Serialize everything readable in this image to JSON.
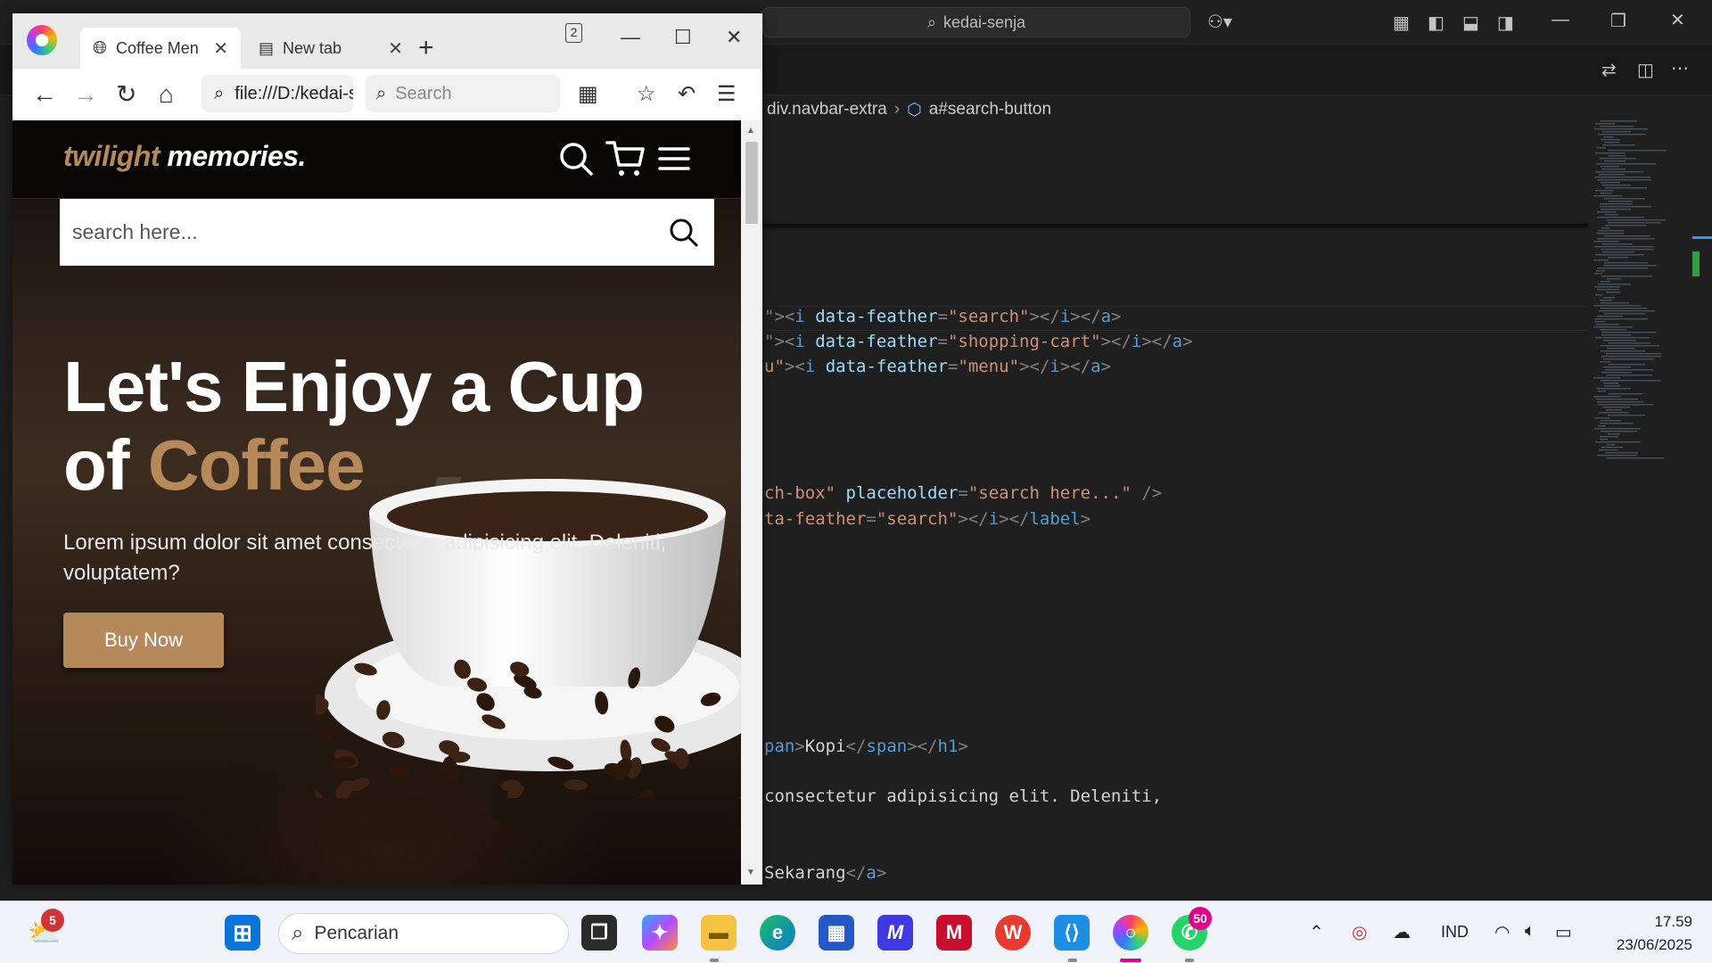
{
  "vscode": {
    "command_center": "kedai-senja",
    "breadcrumb": [
      "div.navbar-extra",
      "a#search-button"
    ],
    "code_lines": [
      {
        "parts": [
          [
            "punc",
            "\">"
          ],
          [
            "punc",
            "<"
          ],
          [
            "tag",
            "i"
          ],
          [
            "attr",
            " data-feather"
          ],
          [
            "punc",
            "="
          ],
          [
            "str",
            "\"search\""
          ],
          [
            "punc",
            "></"
          ],
          [
            "tag",
            "i"
          ],
          [
            "punc",
            "></"
          ],
          [
            "tag",
            "a"
          ],
          [
            "punc",
            ">"
          ]
        ]
      },
      {
        "parts": [
          [
            "punc",
            "\">"
          ],
          [
            "punc",
            "<"
          ],
          [
            "tag",
            "i"
          ],
          [
            "attr",
            " data-feather"
          ],
          [
            "punc",
            "="
          ],
          [
            "str",
            "\"shopping-cart\""
          ],
          [
            "punc",
            "></"
          ],
          [
            "tag",
            "i"
          ],
          [
            "punc",
            "></"
          ],
          [
            "tag",
            "a"
          ],
          [
            "punc",
            ">"
          ]
        ]
      },
      {
        "parts": [
          [
            "str",
            "u\""
          ],
          [
            "punc",
            ">"
          ],
          [
            "punc",
            "<"
          ],
          [
            "tag",
            "i"
          ],
          [
            "attr",
            " data-feather"
          ],
          [
            "punc",
            "="
          ],
          [
            "str",
            "\"menu\""
          ],
          [
            "punc",
            "></"
          ],
          [
            "tag",
            "i"
          ],
          [
            "punc",
            "></"
          ],
          [
            "tag",
            "a"
          ],
          [
            "punc",
            ">"
          ]
        ]
      },
      {
        "parts": [
          [
            "str",
            "ch-box\""
          ],
          [
            "attr",
            " placeholder"
          ],
          [
            "punc",
            "="
          ],
          [
            "str",
            "\"search here...\""
          ],
          [
            "punc",
            " />"
          ]
        ]
      },
      {
        "parts": [
          [
            "str",
            "ta-feather"
          ],
          [
            "punc",
            "="
          ],
          [
            "str",
            "\"search\""
          ],
          [
            "punc",
            "></"
          ],
          [
            "tag",
            "i"
          ],
          [
            "punc",
            "></"
          ],
          [
            "tag",
            "label"
          ],
          [
            "punc",
            ">"
          ]
        ]
      },
      {
        "parts": [
          [
            "tag",
            "pan"
          ],
          [
            "punc",
            ">"
          ],
          [
            "text",
            "Kopi"
          ],
          [
            "punc",
            "</"
          ],
          [
            "tag",
            "span"
          ],
          [
            "punc",
            "></"
          ],
          [
            "tag",
            "h1"
          ],
          [
            "punc",
            ">"
          ]
        ]
      },
      {
        "parts": [
          [
            "text",
            "consectetur adipisicing elit. Deleniti,"
          ]
        ]
      },
      {
        "parts": [
          [
            "text",
            "Sekarang"
          ],
          [
            "punc",
            "</"
          ],
          [
            "tag",
            "a"
          ],
          [
            "punc",
            ">"
          ]
        ]
      }
    ]
  },
  "browser": {
    "tabs": [
      {
        "label": "Coffee Menu"
      },
      {
        "label": "New tab"
      }
    ],
    "tab_count": "2",
    "url": "file:///D:/kedai-senja/index.html",
    "search_placeholder": "Search"
  },
  "site": {
    "logo_accent": "twilight",
    "logo_rest": " memories",
    "logo_dot": ".",
    "search_placeholder": "search here...",
    "hero_title_line1": "Let's Enjoy a Cup",
    "hero_title_of": "of ",
    "hero_title_accent": "Coffee",
    "hero_text": "Lorem ipsum dolor sit amet consectetur adipisicing elit. Deleniti, voluptatem?",
    "buy_button": "Buy Now",
    "accent_color": "#b6895b"
  },
  "taskbar": {
    "weather_badge": "5",
    "search_placeholder": "Pencarian",
    "whatsapp_badge": "50",
    "language": "IND",
    "time": "17.59",
    "date": "23/06/2025"
  }
}
